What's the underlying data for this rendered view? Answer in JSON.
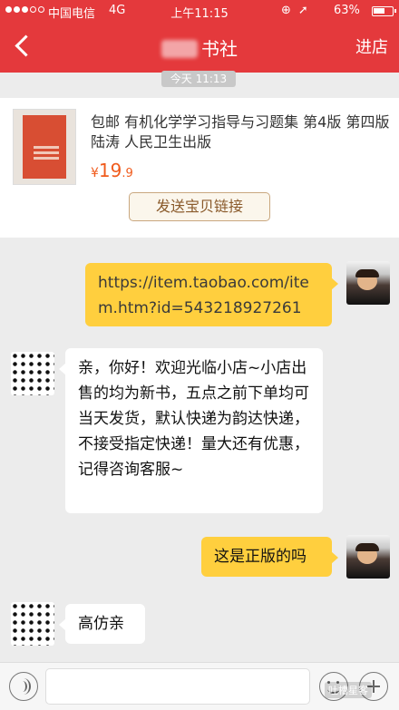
{
  "status_bar": {
    "carrier": "中国电信",
    "network": "4G",
    "time": "上午11:15",
    "battery": "63%",
    "battery_level": 0.63
  },
  "nav": {
    "title_suffix": "书社",
    "shop_link": "进店"
  },
  "timestamp": "今天 11:13",
  "product": {
    "title": "包邮 有机化学学习指导与习题集 第4版 第四版 陆涛 人民卫生出版",
    "price_symbol": "¥",
    "price_int": "19",
    "price_dec": ".9",
    "send_link_label": "发送宝贝链接"
  },
  "messages": [
    {
      "sender": "me",
      "text": "https://item.taobao.com/item.htm?id=543218927261"
    },
    {
      "sender": "seller",
      "text": "亲，你好！欢迎光临小店~小店出售的均为新书，五点之前下单均可当天发货，默认快递为韵达快递，不接受指定快递！量大还有优惠，记得咨询客服~"
    },
    {
      "sender": "me",
      "text": "这是正版的吗"
    },
    {
      "sender": "seller",
      "text": "高仿亲"
    }
  ],
  "watermark": "吐槽星客",
  "colors": {
    "brand_red": "#e4393c",
    "my_bubble": "#ffcf3e",
    "price": "#f05b1c"
  }
}
